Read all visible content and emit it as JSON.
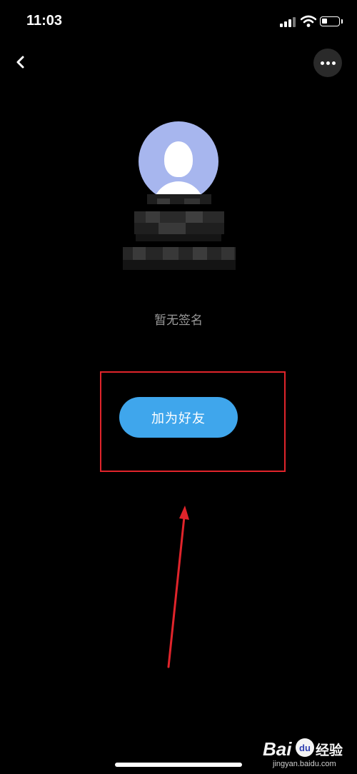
{
  "status_bar": {
    "time": "11:03"
  },
  "profile": {
    "signature": "暂无签名"
  },
  "actions": {
    "add_friend_label": "加为好友"
  },
  "watermark": {
    "brand_bai": "Bai",
    "brand_du": "du",
    "brand_cn": "经验",
    "url": "jingyan.baidu.com"
  },
  "colors": {
    "accent": "#3fa6ec",
    "highlight": "#e0242b",
    "avatar_bg": "#a7b6ee"
  },
  "icons": {
    "back": "chevron-left-icon",
    "more": "more-dots-icon",
    "avatar": "default-avatar-icon"
  }
}
